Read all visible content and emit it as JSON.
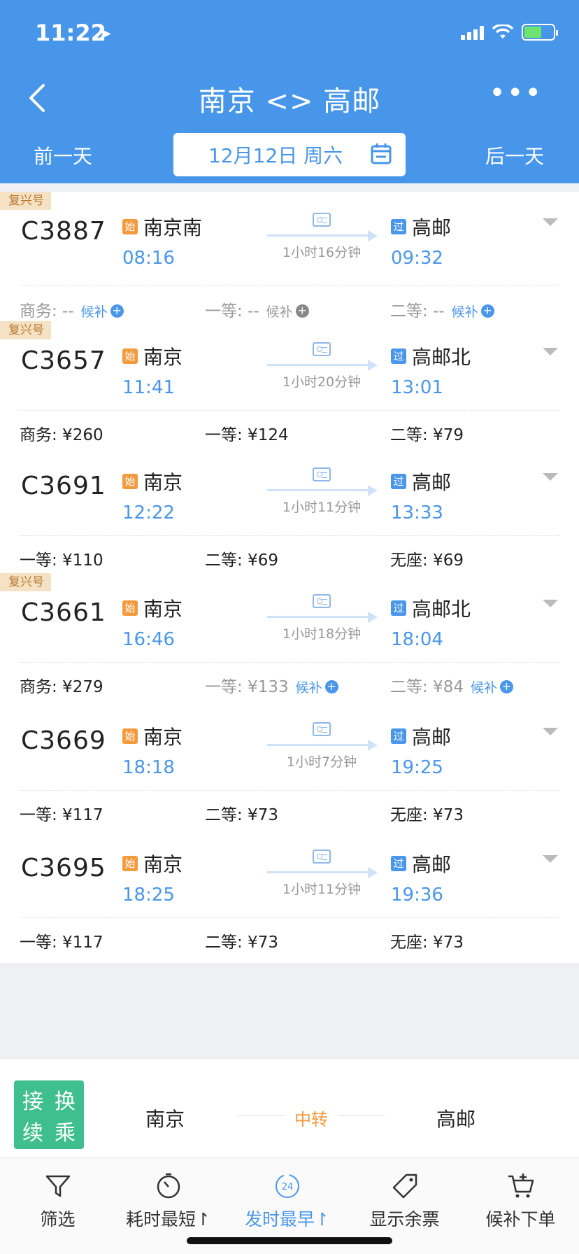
{
  "status": {
    "time": "11:22"
  },
  "header": {
    "title": "南京 <> 高邮",
    "prev_day": "前一天",
    "next_day": "后一天",
    "date": "12月12日 周六"
  },
  "trains": [
    {
      "badge": "复兴号",
      "no": "C3887",
      "dep_tag": "始",
      "dep_station": "南京南",
      "dep_time": "08:16",
      "duration": "1小时16分钟",
      "arr_tag": "过",
      "arr_station": "高邮",
      "arr_time": "09:32",
      "seats": [
        {
          "label": "商务: --",
          "waitlist": "候补",
          "style": "grey",
          "wl_color": "blue"
        },
        {
          "label": "一等: --",
          "waitlist": "候补",
          "style": "grey",
          "wl_color": "grey"
        },
        {
          "label": "二等: --",
          "waitlist": "候补",
          "style": "grey",
          "wl_color": "blue"
        }
      ]
    },
    {
      "badge": "复兴号",
      "no": "C3657",
      "dep_tag": "始",
      "dep_station": "南京",
      "dep_time": "11:41",
      "duration": "1小时20分钟",
      "arr_tag": "过",
      "arr_station": "高邮北",
      "arr_time": "13:01",
      "seats": [
        {
          "label": "商务: ¥260",
          "waitlist": "",
          "style": "normal"
        },
        {
          "label": "一等: ¥124",
          "waitlist": "",
          "style": "normal"
        },
        {
          "label": "二等: ¥79",
          "waitlist": "",
          "style": "normal"
        }
      ]
    },
    {
      "badge": "",
      "no": "C3691",
      "dep_tag": "始",
      "dep_station": "南京",
      "dep_time": "12:22",
      "duration": "1小时11分钟",
      "arr_tag": "过",
      "arr_station": "高邮",
      "arr_time": "13:33",
      "seats": [
        {
          "label": "一等: ¥110",
          "waitlist": "",
          "style": "normal"
        },
        {
          "label": "二等: ¥69",
          "waitlist": "",
          "style": "normal"
        },
        {
          "label": "无座: ¥69",
          "waitlist": "",
          "style": "normal"
        }
      ]
    },
    {
      "badge": "复兴号",
      "no": "C3661",
      "dep_tag": "始",
      "dep_station": "南京",
      "dep_time": "16:46",
      "duration": "1小时18分钟",
      "arr_tag": "过",
      "arr_station": "高邮北",
      "arr_time": "18:04",
      "seats": [
        {
          "label": "商务: ¥279",
          "waitlist": "",
          "style": "normal"
        },
        {
          "label": "一等: ¥133",
          "waitlist": "候补",
          "style": "grey",
          "wl_color": "blue"
        },
        {
          "label": "二等: ¥84",
          "waitlist": "候补",
          "style": "grey",
          "wl_color": "blue"
        }
      ]
    },
    {
      "badge": "",
      "no": "C3669",
      "dep_tag": "始",
      "dep_station": "南京",
      "dep_time": "18:18",
      "duration": "1小时7分钟",
      "arr_tag": "过",
      "arr_station": "高邮",
      "arr_time": "19:25",
      "seats": [
        {
          "label": "一等: ¥117",
          "waitlist": "",
          "style": "normal"
        },
        {
          "label": "二等: ¥73",
          "waitlist": "",
          "style": "normal"
        },
        {
          "label": "无座: ¥73",
          "waitlist": "",
          "style": "normal"
        }
      ]
    },
    {
      "badge": "",
      "no": "C3695",
      "dep_tag": "始",
      "dep_station": "南京",
      "dep_time": "18:25",
      "duration": "1小时11分钟",
      "arr_tag": "过",
      "arr_station": "高邮",
      "arr_time": "19:36",
      "seats": [
        {
          "label": "一等: ¥117",
          "waitlist": "",
          "style": "normal"
        },
        {
          "label": "二等: ¥73",
          "waitlist": "",
          "style": "normal"
        },
        {
          "label": "无座: ¥73",
          "waitlist": "",
          "style": "normal"
        }
      ]
    }
  ],
  "transfer": {
    "logo_chars": [
      "接",
      "换",
      "续",
      "乘"
    ],
    "from": "南京",
    "via": "中转",
    "to": "高邮"
  },
  "tabs": [
    {
      "label": "筛选",
      "icon": "filter-icon"
    },
    {
      "label": "耗时最短↾",
      "icon": "timer-icon"
    },
    {
      "label": "发时最早↾",
      "icon": "clock-24-icon",
      "badge": "24",
      "active": true
    },
    {
      "label": "显示余票",
      "icon": "ticket-tag-icon"
    },
    {
      "label": "候补下单",
      "icon": "cart-icon"
    }
  ],
  "colors": {
    "primary": "#4796ea",
    "orange": "#f39a3d",
    "green": "#3fbe8e"
  }
}
